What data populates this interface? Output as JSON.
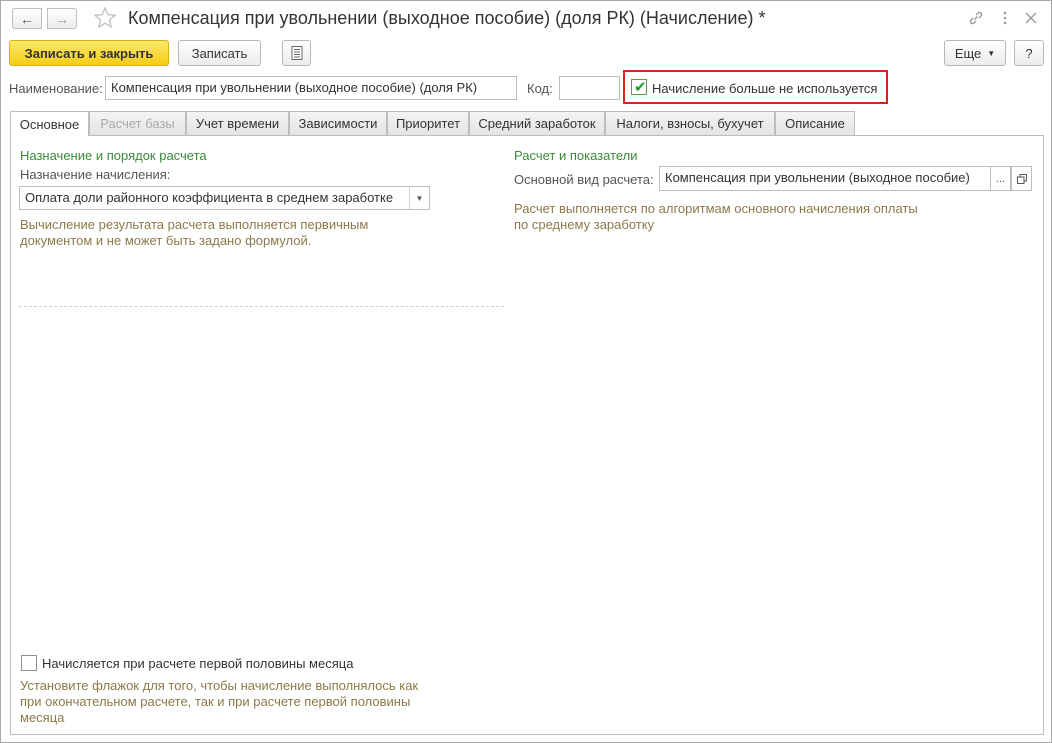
{
  "window": {
    "title": "Компенсация при увольнении (выходное пособие) (доля РК) (Начисление) *"
  },
  "toolbar": {
    "save_close_label": "Записать и закрыть",
    "save_label": "Записать",
    "more_label": "Еще",
    "help_label": "?"
  },
  "header": {
    "name_label": "Наименование:",
    "name_value": "Компенсация при увольнении (выходное пособие) (доля РК)",
    "code_label": "Код:",
    "code_value": "",
    "not_used_label": "Начисление больше не используется",
    "not_used_checked": true
  },
  "tabs": [
    {
      "label": "Основное",
      "active": true,
      "disabled": false
    },
    {
      "label": "Расчет базы",
      "active": false,
      "disabled": true
    },
    {
      "label": "Учет времени",
      "active": false,
      "disabled": false
    },
    {
      "label": "Зависимости",
      "active": false,
      "disabled": false
    },
    {
      "label": "Приоритет",
      "active": false,
      "disabled": false
    },
    {
      "label": "Средний заработок",
      "active": false,
      "disabled": false
    },
    {
      "label": "Налоги, взносы, бухучет",
      "active": false,
      "disabled": false
    },
    {
      "label": "Описание",
      "active": false,
      "disabled": false
    }
  ],
  "left": {
    "section_title": "Назначение и порядок расчета",
    "purpose_label": "Назначение начисления:",
    "purpose_value": "Оплата доли районного коэффициента в среднем заработке",
    "hint": "Вычисление результата расчета выполняется первичным документом и не может быть задано формулой.",
    "half_month_label": "Начисляется при расчете первой половины месяца",
    "half_month_checked": false,
    "half_month_hint": "Установите флажок для того, чтобы начисление выполнялось как при окончательном расчете, так и при расчете первой половины месяца"
  },
  "right": {
    "section_title": "Расчет и показатели",
    "main_type_label": "Основной вид расчета:",
    "main_type_value": "Компенсация при увольнении (выходное пособие)",
    "hint": "Расчет выполняется по алгоритмам основного начисления оплаты по среднему заработку"
  },
  "colors": {
    "primary_button": "#f5cd16",
    "section_title": "#3a8a3a",
    "hint_text": "#8a7a4a",
    "highlight_border": "#e02020"
  }
}
